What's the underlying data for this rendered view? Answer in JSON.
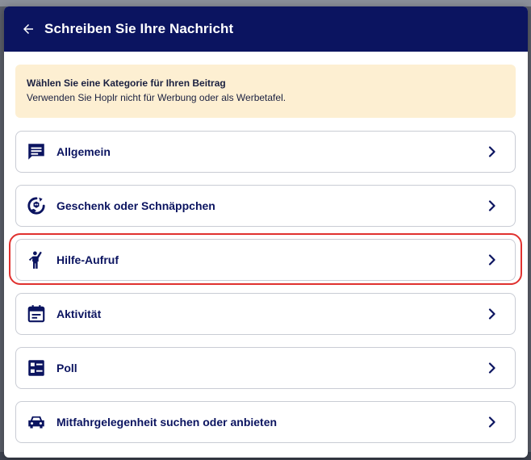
{
  "header": {
    "title": "Schreiben Sie Ihre Nachricht",
    "back_icon": "arrow-left-icon"
  },
  "notice": {
    "title": "Wählen Sie eine Kategorie für Ihren Beitrag",
    "text": "Verwenden Sie Hoplr nicht für Werbung oder als Werbetafel."
  },
  "categories": [
    {
      "label": "Allgemein",
      "icon": "chat-icon"
    },
    {
      "label": "Geschenk oder Schnäppchen",
      "icon": "gift-deal-icon"
    },
    {
      "label": "Hilfe-Aufruf",
      "icon": "raised-hand-person-icon",
      "highlighted": true
    },
    {
      "label": "Aktivität",
      "icon": "calendar-icon"
    },
    {
      "label": "Poll",
      "icon": "poll-icon"
    },
    {
      "label": "Mitfahrgelegenheit suchen oder anbieten",
      "icon": "car-icon"
    }
  ],
  "colors": {
    "header": "#0b1460",
    "notice": "#fdefd2",
    "highlight": "#e0312f",
    "text": "#0b1460"
  }
}
